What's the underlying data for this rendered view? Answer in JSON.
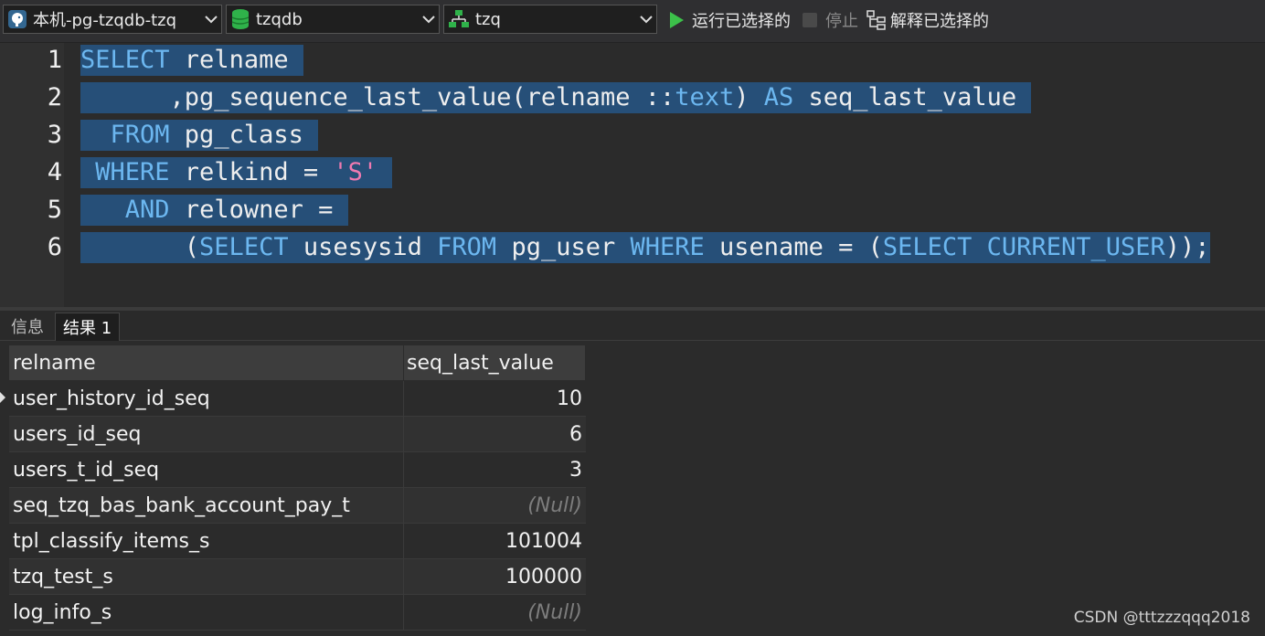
{
  "toolbar": {
    "connection": "本机-pg-tzqdb-tzq",
    "database": "tzqdb",
    "schema": "tzq",
    "run_selected": "运行已选择的",
    "stop": "停止",
    "explain_selected": "解释已选择的",
    "icons": [
      "postgres-elephant-icon",
      "database-icon",
      "schema-icon",
      "chevron-down-icon",
      "play-icon",
      "stop-icon",
      "explain-icon"
    ],
    "colors": {
      "play": "#3cc04a",
      "database": "#2fb24a",
      "selection": "#264f78",
      "keyword": "#6cb7f0",
      "string": "#f07ab1"
    }
  },
  "editor": {
    "line_numbers": [
      "1",
      "2",
      "3",
      "4",
      "5",
      "6"
    ],
    "lines": [
      [
        {
          "t": "SELECT",
          "k": "kw"
        },
        {
          "t": " relname ",
          "k": ""
        }
      ],
      [
        {
          "t": "      ,pg_sequence_last_value(relname ::",
          "k": ""
        },
        {
          "t": "text",
          "k": "kw"
        },
        {
          "t": ") ",
          "k": ""
        },
        {
          "t": "AS",
          "k": "kw"
        },
        {
          "t": " seq_last_value ",
          "k": ""
        }
      ],
      [
        {
          "t": "  ",
          "k": ""
        },
        {
          "t": "FROM",
          "k": "kw"
        },
        {
          "t": " pg_class ",
          "k": ""
        }
      ],
      [
        {
          "t": " ",
          "k": ""
        },
        {
          "t": "WHERE",
          "k": "kw"
        },
        {
          "t": " relkind = ",
          "k": ""
        },
        {
          "t": "'S'",
          "k": "str"
        },
        {
          "t": " ",
          "k": ""
        }
      ],
      [
        {
          "t": "   ",
          "k": ""
        },
        {
          "t": "AND",
          "k": "kw"
        },
        {
          "t": " relowner = ",
          "k": ""
        }
      ],
      [
        {
          "t": "       (",
          "k": ""
        },
        {
          "t": "SELECT",
          "k": "kw"
        },
        {
          "t": " usesysid ",
          "k": ""
        },
        {
          "t": "FROM",
          "k": "kw"
        },
        {
          "t": " pg_user ",
          "k": ""
        },
        {
          "t": "WHERE",
          "k": "kw"
        },
        {
          "t": " usename = (",
          "k": ""
        },
        {
          "t": "SELECT",
          "k": "kw"
        },
        {
          "t": " ",
          "k": ""
        },
        {
          "t": "CURRENT_USER",
          "k": "kw"
        },
        {
          "t": "));",
          "k": ""
        }
      ]
    ]
  },
  "results": {
    "tabs": [
      "信息",
      "结果 1"
    ],
    "active_tab": "结果 1",
    "columns": [
      "relname",
      "seq_last_value"
    ],
    "rows": [
      [
        "user_history_id_seq",
        "10"
      ],
      [
        "users_id_seq",
        "6"
      ],
      [
        "users_t_id_seq",
        "3"
      ],
      [
        "seq_tzq_bas_bank_account_pay_t",
        "(Null)"
      ],
      [
        "tpl_classify_items_s",
        "101004"
      ],
      [
        "tzq_test_s",
        "100000"
      ],
      [
        "log_info_s",
        "(Null)"
      ]
    ]
  },
  "watermark": "CSDN @tttzzzqqq2018"
}
